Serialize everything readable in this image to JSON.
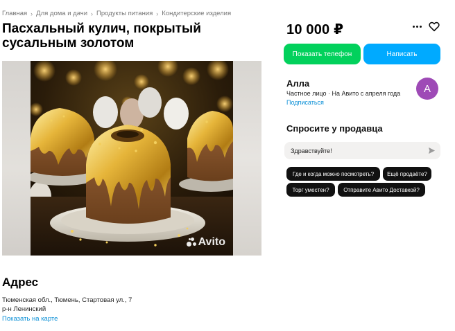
{
  "breadcrumb": {
    "items": [
      "Главная",
      "Для дома и дачи",
      "Продукты питания",
      "Кондитерские изделия"
    ],
    "separator_icon": "chevron-right-icon"
  },
  "listing": {
    "title_line1": "Пасхальный кулич, покрытый",
    "title_line2": "сусальным золотом",
    "price": "10 000 ₽"
  },
  "gallery": {
    "watermark": "Avito"
  },
  "address": {
    "heading": "Адрес",
    "line1": "Тюменская обл., Тюмень, Стартовая ул., 7",
    "line2": "р-н Ленинский",
    "map_link": "Показать на карте"
  },
  "actions": {
    "show_phone": "Показать телефон",
    "write": "Написать",
    "phone_color": "#02d15c",
    "write_color": "#00aaff"
  },
  "seller": {
    "name": "Алла",
    "meta": "Частное лицо · На Авито с апреля года",
    "subscribe": "Подписаться",
    "avatar_letter": "А",
    "avatar_color": "#9e4ab6"
  },
  "ask": {
    "heading": "Спросите у продавца",
    "message": "Здравствуйте!",
    "chips": [
      "Где и когда можно посмотреть?",
      "Ещё продаёте?",
      "Торг уместен?",
      "Отправите Авито Доставкой?"
    ]
  },
  "icons": {
    "more": "more-horizontal-icon",
    "favorite": "heart-icon",
    "send": "send-icon"
  }
}
